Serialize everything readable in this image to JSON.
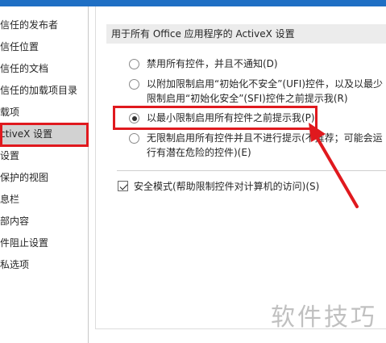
{
  "sidebar": {
    "items": [
      {
        "label": "受信任的发布者"
      },
      {
        "label": "受信任位置"
      },
      {
        "label": "受信任的文档"
      },
      {
        "label": "受信任的加载项目录"
      },
      {
        "label": "加载项"
      },
      {
        "label": "ActiveX 设置"
      },
      {
        "label": "宏设置"
      },
      {
        "label": "受保护的视图"
      },
      {
        "label": "消息栏"
      },
      {
        "label": "外部内容"
      },
      {
        "label": "文件阻止设置"
      },
      {
        "label": "隐私选项"
      }
    ],
    "selected_index": 5
  },
  "activex": {
    "section_title": "用于所有 Office 应用程序的 ActiveX 设置",
    "options": [
      {
        "line1": "禁用所有控件，并且不通知(D)",
        "line2": "",
        "checked": false
      },
      {
        "line1": "以附加限制启用“初始化不安全”(UFI)控件，以及以最少",
        "line2": "限制启用“初始化安全”(SFI)控件之前提示我(R)",
        "checked": false
      },
      {
        "line1": "以最小限制启用所有控件之前提示我(P)",
        "line2": "",
        "checked": true
      },
      {
        "line1": "无限制启用所有控件并且不进行提示(不推荐；可能会运",
        "line2": "行有潜在危险的控件)(E)",
        "checked": false
      }
    ],
    "safe_mode": {
      "label": "安全模式(帮助限制控件对计算机的访问)(S)",
      "checked": true
    }
  },
  "annotation_color": "#e0191e",
  "watermark": "软件技巧"
}
